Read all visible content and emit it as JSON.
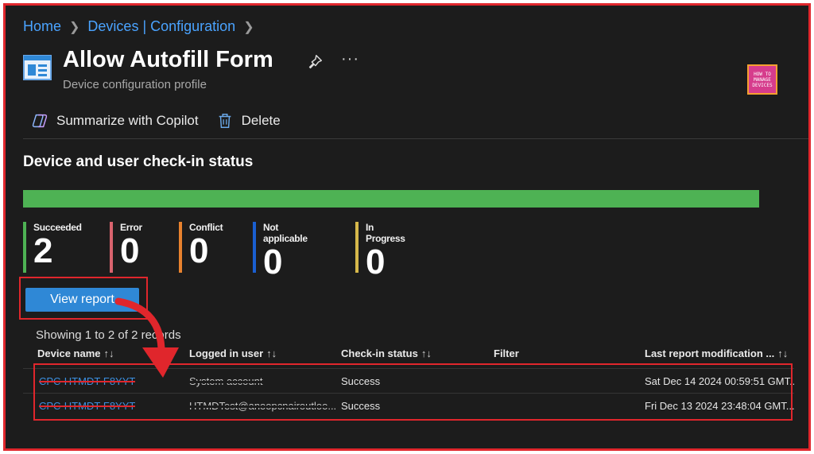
{
  "breadcrumb": {
    "home": "Home",
    "devices": "Devices | Configuration"
  },
  "header": {
    "title": "Allow Autofill Form",
    "subtitle": "Device configuration profile",
    "more_label": "···",
    "logo_lines": [
      "HOW TO",
      "MANAGE",
      "DEVICES"
    ]
  },
  "toolbar": {
    "copilot_label": "Summarize with Copilot",
    "delete_label": "Delete"
  },
  "section": {
    "title": "Device and user check-in status"
  },
  "status": {
    "success_fraction": 1.0,
    "stats": [
      {
        "label": "Succeeded",
        "value": "2",
        "color": "#4eb254"
      },
      {
        "label": "Error",
        "value": "0",
        "color": "#d9636e"
      },
      {
        "label": "Conflict",
        "value": "0",
        "color": "#e8822e"
      },
      {
        "label": "Not applicable",
        "value": "0",
        "color": "#1a5fd1"
      },
      {
        "label": "In Progress",
        "value": "0",
        "color": "#d6b84a"
      }
    ]
  },
  "view_report_label": "View report",
  "showing": "Showing 1 to 2 of 2 records",
  "table": {
    "columns": [
      "Device name",
      "Logged in user",
      "Check-in status",
      "Filter",
      "Last report modification ..."
    ],
    "sort_glyph": "↑↓",
    "rows": [
      {
        "device": "CPC-HTMDT-F8YYT",
        "user": "System account",
        "status": "Success",
        "filter": "",
        "modified": "Sat Dec 14 2024 00:59:51 GMT..."
      },
      {
        "device": "CPC-HTMDT-F8YYT",
        "user": "HTMDTest@anoopcnairoutloo...",
        "status": "Success",
        "filter": "",
        "modified": "Fri Dec 13 2024 23:48:04 GMT..."
      }
    ]
  }
}
